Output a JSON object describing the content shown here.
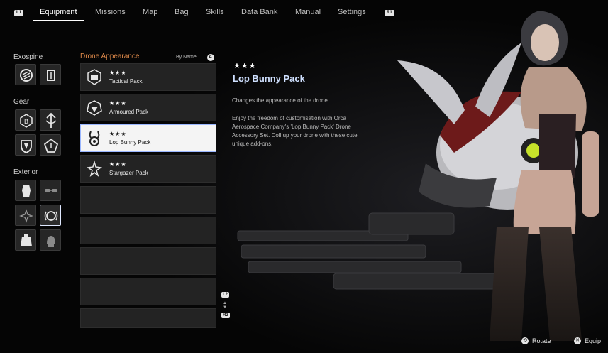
{
  "nav": {
    "left_button": "L1",
    "right_button": "R1",
    "tabs": [
      {
        "label": "Equipment"
      },
      {
        "label": "Missions"
      },
      {
        "label": "Map"
      },
      {
        "label": "Bag"
      },
      {
        "label": "Skills"
      },
      {
        "label": "Data Bank"
      },
      {
        "label": "Manual"
      },
      {
        "label": "Settings"
      }
    ],
    "active_tab": "Equipment"
  },
  "sidebar": {
    "sections": [
      {
        "label": "Exospine",
        "icons": [
          "exospine-core-icon",
          "exospine-shield-icon"
        ]
      },
      {
        "label": "Gear",
        "icons": [
          "gear-b-icon",
          "gear-sword-icon",
          "gear-shield-icon",
          "gear-pentagon-icon"
        ]
      },
      {
        "label": "Exterior",
        "icons": [
          "suit-icon",
          "glasses-icon",
          "sparkle-icon",
          "drone-icon",
          "backpack-icon",
          "helmet-icon"
        ]
      }
    ],
    "selected_icon": "drone-icon"
  },
  "list": {
    "heading": "Drone Appearance",
    "sort_label": "By Name",
    "sort_button": "A",
    "items": [
      {
        "stars": "★★★",
        "name": "Tactical Pack",
        "icon": "tactical-pack-icon"
      },
      {
        "stars": "★★★",
        "name": "Armoured Pack",
        "icon": "armoured-pack-icon"
      },
      {
        "stars": "★★★",
        "name": "Lop Bunny Pack",
        "icon": "lop-bunny-pack-icon"
      },
      {
        "stars": "★★★",
        "name": "Stargazer Pack",
        "icon": "stargazer-pack-icon"
      }
    ],
    "selected_index": 2,
    "empty_slots": 5,
    "scroll_up": "L2",
    "scroll_down": "R2"
  },
  "detail": {
    "stars": "★★★",
    "title": "Lop Bunny Pack",
    "short_desc": "Changes the appearance of the drone.",
    "long_desc": "Enjoy the freedom of customisation with Orca Aerospace Company's 'Lop Bunny Pack' Drone Accessory Set. Doll up your drone with these cute, unique add-ons."
  },
  "hints": {
    "rotate_label": "Rotate",
    "equip_label": "Equip"
  },
  "colors": {
    "accent_orange": "#e08a4a",
    "title_blue": "#cfe0ff",
    "selection_border": "#9bb7ff"
  }
}
